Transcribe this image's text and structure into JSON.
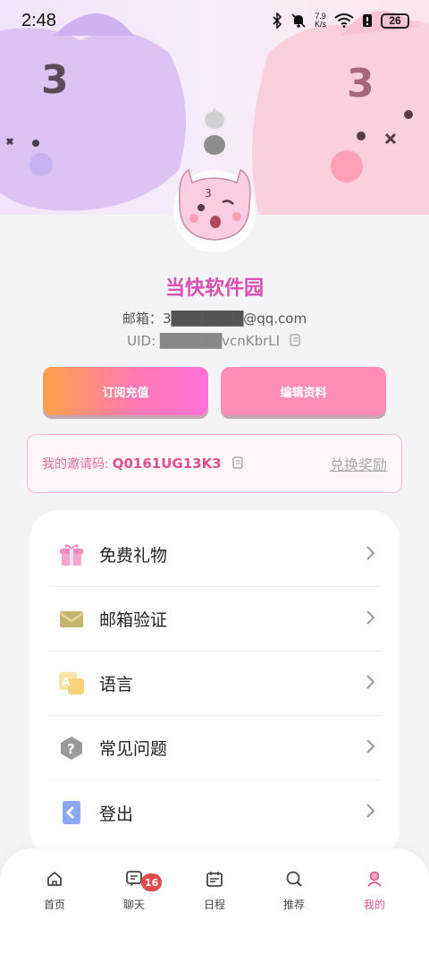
{
  "status_bar": {
    "time": "2:48",
    "net_speed_value": "7.9",
    "net_speed_unit": "K/s",
    "battery": "26"
  },
  "profile": {
    "nickname": "当快软件园",
    "email_label": "邮箱：",
    "email_value": "3███████@qq.com",
    "uid_label": "UID: ",
    "uid_value": "██████vcnKbrLI"
  },
  "actions": {
    "subscribe_label": "订阅充值",
    "edit_label": "编辑资料"
  },
  "invite": {
    "label": "我的邀请码:",
    "code": "Q0161UG13K3",
    "redeem_label": "兑换奖励"
  },
  "menu": {
    "items": [
      {
        "label": "免费礼物",
        "icon": "gift-icon"
      },
      {
        "label": "邮箱验证",
        "icon": "envelope-icon"
      },
      {
        "label": "语言",
        "icon": "translate-icon"
      },
      {
        "label": "常见问题",
        "icon": "question-icon"
      },
      {
        "label": "登出",
        "icon": "logout-icon"
      }
    ]
  },
  "tabbar": {
    "tabs": [
      {
        "label": "首页",
        "icon": "home-icon"
      },
      {
        "label": "聊天",
        "icon": "chat-icon",
        "badge": "16"
      },
      {
        "label": "日程",
        "icon": "calendar-icon"
      },
      {
        "label": "推荐",
        "icon": "search-icon"
      },
      {
        "label": "我的",
        "icon": "profile-icon"
      }
    ],
    "active_index": 4
  },
  "colors": {
    "accent": "#e0508e",
    "nickname": "#d94fb3",
    "badge": "#e34a4a"
  }
}
